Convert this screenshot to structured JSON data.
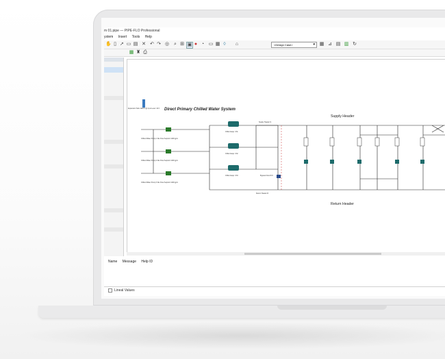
{
  "window": {
    "title": "m 01.pipe — PIPE-FLO Professional"
  },
  "menu": [
    "ystem",
    "Insert",
    "Tools",
    "Help"
  ],
  "toolbar": {
    "design_case": "<Design Case>",
    "icons": [
      "hand-icon",
      "doc-icon",
      "clipboard-icon",
      "cut-icon",
      "undo-icon",
      "redo-icon",
      "binoculars-icon",
      "zoom-icon",
      "fit-icon",
      "screen-icon",
      "color-wheel-icon",
      "gauge-icon",
      "layers-icon",
      "drop-icon",
      "spacer",
      "grid-icon",
      "chart-icon",
      "report-icon",
      "sheet-icon",
      "refresh-icon"
    ]
  },
  "diagram": {
    "title": "Direct Primary Chilled Water System",
    "supply_header": "Supply Header",
    "return_header": "Return Header",
    "pumps": [
      {
        "label": "Chilled Water Pump 1\nDa: Flow Setpoint 1200 gpm"
      },
      {
        "label": "Chilled Water Pump 2\nDa: Flow Setpoint 1200 gpm"
      },
      {
        "label": "Chilled Water Pump 3\nDa: Flow Setpoint 1200 gpm"
      }
    ],
    "chillers": [
      "Chiller Evap. Ch1",
      "Chiller Evap. Ch2",
      "Chiller Evap. Ch3"
    ],
    "tank_label": "Expansion Tank\n1020 ft @ 4 psi\nLevel: 10 ft",
    "bypass_label": "Bypass Flow FCV",
    "supply_node_label": "Supply Header S",
    "return_node_label": "Return Header R"
  },
  "messages": {
    "columns": [
      "Name",
      "Message",
      "Help ID"
    ]
  },
  "status": {
    "lineal_values": "Lineal Values"
  }
}
